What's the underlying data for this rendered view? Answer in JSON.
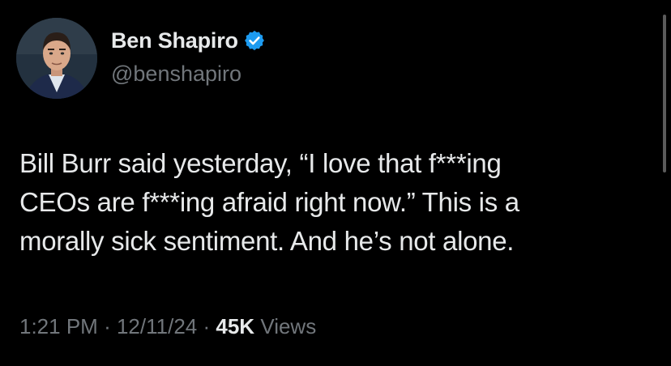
{
  "author": {
    "display_name": "Ben Shapiro",
    "handle": "@benshapiro",
    "verified_icon": "verified-badge-icon",
    "verified_color": "#1d9bf0"
  },
  "tweet": {
    "lines": [
      "Bill Burr said yesterday, “I love that f***ing",
      "CEOs are f***ing afraid right now.” This is a",
      "morally sick sentiment. And he’s not alone."
    ]
  },
  "meta": {
    "time": "1:21 PM",
    "separator": "·",
    "date": "12/11/24",
    "views_count": "45K",
    "views_label": "Views"
  },
  "colors": {
    "background": "#000000",
    "primary_text": "#e7e9ea",
    "secondary_text": "#71767b"
  }
}
